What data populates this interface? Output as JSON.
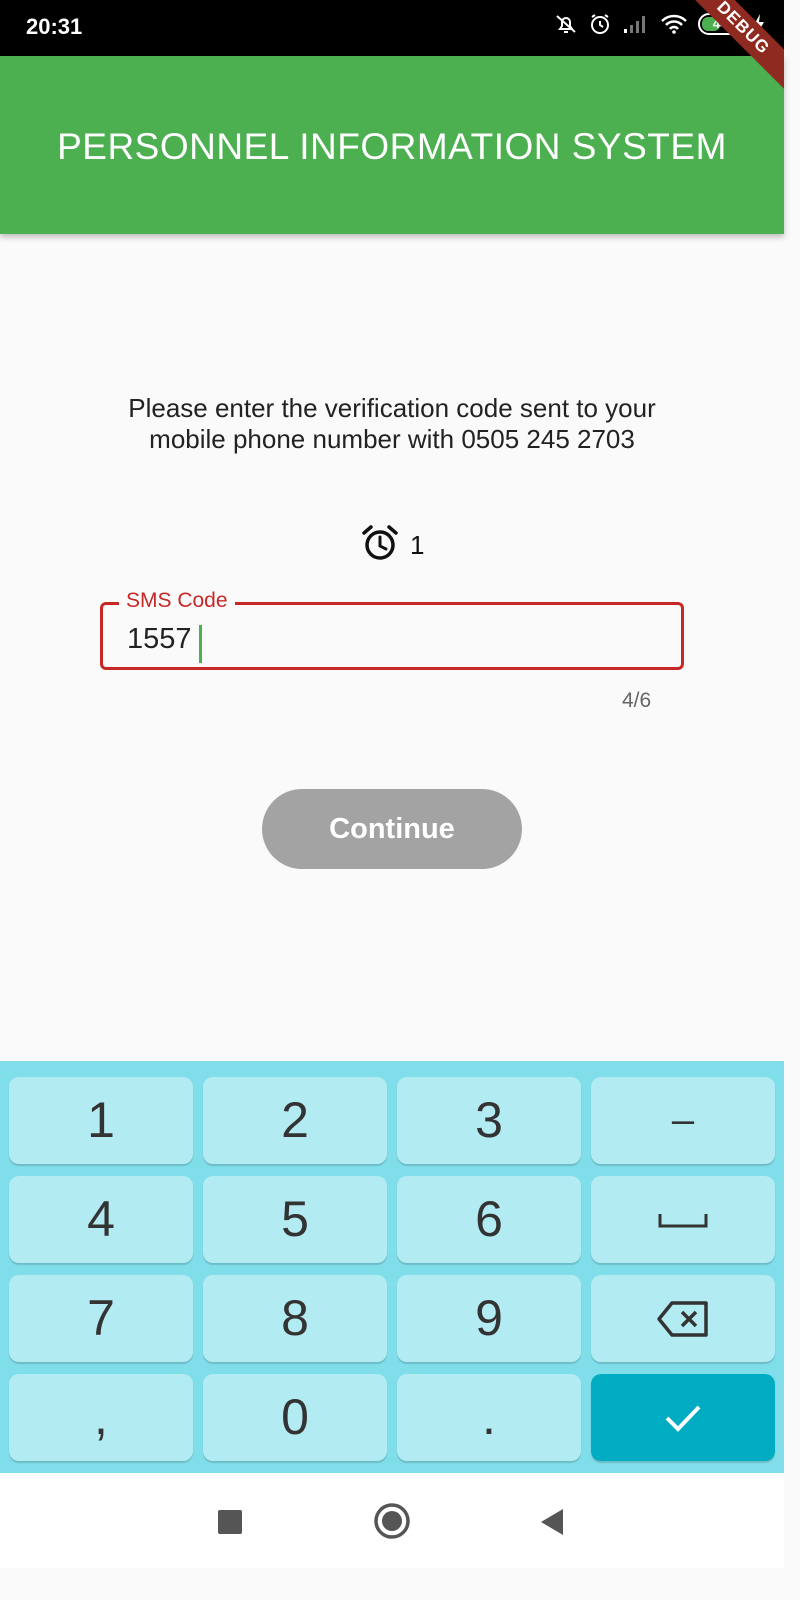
{
  "status_bar": {
    "time": "20:31",
    "battery_level": "44",
    "icons": [
      "muted-bell-icon",
      "alarm-icon",
      "signal-icon",
      "wifi-icon",
      "battery-icon",
      "charging-icon"
    ]
  },
  "app_bar": {
    "title": "PERSONNEL INFORMATION SYSTEM",
    "color": "#4caf50",
    "debug_banner": "DEBUG"
  },
  "verification": {
    "message": "Please enter the verification code sent to your mobile phone number with 0505 245 2703",
    "timer_icon": "alarm-clock-icon",
    "timer_value": "1"
  },
  "sms_field": {
    "label": "SMS Code",
    "value": "1557",
    "counter": "4/6",
    "error_color": "#c62828"
  },
  "continue_button": {
    "label": "Continue",
    "color": "#a3a3a3"
  },
  "keyboard": {
    "rows": [
      [
        "1",
        "2",
        "3",
        "–"
      ],
      [
        "4",
        "5",
        "6",
        "space-icon"
      ],
      [
        "7",
        "8",
        "9",
        "backspace-icon"
      ],
      [
        ",",
        "0",
        ".",
        "check-icon"
      ]
    ],
    "background": "#80deea",
    "key_color": "#b2ebf2",
    "enter_color": "#00acc1"
  },
  "nav_bar": {
    "buttons": [
      "recent-apps-icon",
      "home-icon",
      "back-icon"
    ]
  }
}
